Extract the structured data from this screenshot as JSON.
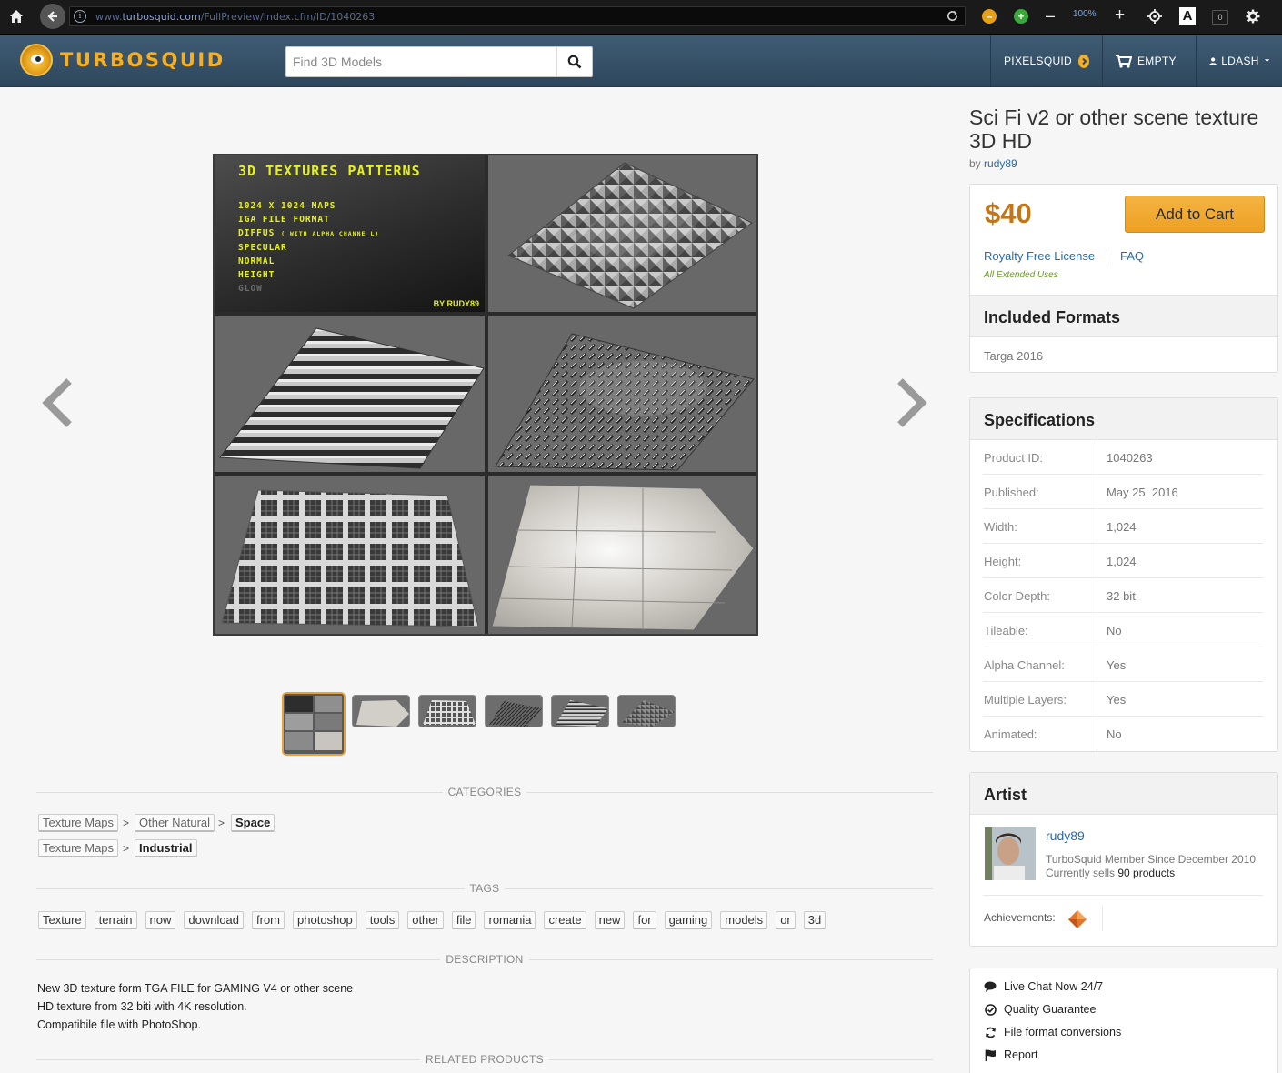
{
  "browser": {
    "url_scheme": "www.",
    "url_host": "turbosquid.com",
    "url_path": "/FullPreview/Index.cfm/ID/1040263",
    "zoom_level": "100%",
    "letter_button": "A",
    "counter": "0"
  },
  "header": {
    "logo_text": "TURBOSQUID",
    "search_placeholder": "Find 3D Models",
    "pixelsquid_label": "PIXELSQUID",
    "cart_label": "EMPTY",
    "user_label": "LDASH"
  },
  "preview": {
    "banner": {
      "title": "3D TEXTURES PATTERNS",
      "lines": [
        "1024 X 1024 MAPS",
        "IGA FILE FORMAT",
        "DIFFUS",
        "SPECULAR",
        "NORMAL",
        "HEIGHT",
        "GLOW"
      ],
      "diffus_suffix": "( WITH ALPHA CHANNE L)",
      "credit": "BY RUDY89"
    },
    "thumbnail_count": 6,
    "active_thumbnail_index": 0
  },
  "categories": {
    "heading": "CATEGORIES",
    "paths": [
      [
        "Texture Maps",
        "Other Natural",
        "Space"
      ],
      [
        "Texture Maps",
        "Industrial"
      ]
    ],
    "separator": ">"
  },
  "tags": {
    "heading": "TAGS",
    "items": [
      "Texture",
      "terrain",
      "now",
      "download",
      "from",
      "photoshop",
      "tools",
      "other",
      "file",
      "romania",
      "create",
      "new",
      "for",
      "gaming",
      "models",
      "or",
      "3d"
    ]
  },
  "description": {
    "heading": "DESCRIPTION",
    "lines": [
      "New 3D texture form TGA FILE for GAMING V4 or other scene",
      "HD texture from 32 biti with 4K resolution.",
      "Compatibile file with PhotoShop."
    ]
  },
  "related": {
    "heading": "RELATED PRODUCTS"
  },
  "product": {
    "title": "Sci Fi v2 or other scene texture 3D HD",
    "by_label": "by",
    "author": "rudy89",
    "price": "$40",
    "add_to_cart": "Add to Cart",
    "license_link": "Royalty Free License",
    "faq_link": "FAQ",
    "license_note": "All Extended Uses"
  },
  "formats": {
    "heading": "Included Formats",
    "items": [
      "Targa 2016"
    ]
  },
  "specifications": {
    "heading": "Specifications",
    "rows": [
      {
        "key": "Product ID:",
        "value": "1040263"
      },
      {
        "key": "Published:",
        "value": "May 25, 2016"
      },
      {
        "key": "Width:",
        "value": "1,024"
      },
      {
        "key": "Height:",
        "value": "1,024"
      },
      {
        "key": "Color Depth:",
        "value": "32 bit"
      },
      {
        "key": "Tileable:",
        "value": "No"
      },
      {
        "key": "Alpha Channel:",
        "value": "Yes"
      },
      {
        "key": "Multiple Layers:",
        "value": "Yes"
      },
      {
        "key": "Animated:",
        "value": "No"
      }
    ]
  },
  "artist": {
    "heading": "Artist",
    "name": "rudy89",
    "member_since": "TurboSquid Member Since December 2010",
    "sells_prefix": "Currently sells",
    "sells_count": "90 products",
    "achievements_label": "Achievements:"
  },
  "services": {
    "items": [
      "Live Chat Now 24/7",
      "Quality Guarantee",
      "File format conversions",
      "Report"
    ]
  },
  "colors": {
    "header_bg": "#34506a",
    "brand_orange": "#f2b02a",
    "price": "#c17717",
    "link": "#2a6aa8",
    "add_to_cart_bg": "#f0a72e"
  }
}
